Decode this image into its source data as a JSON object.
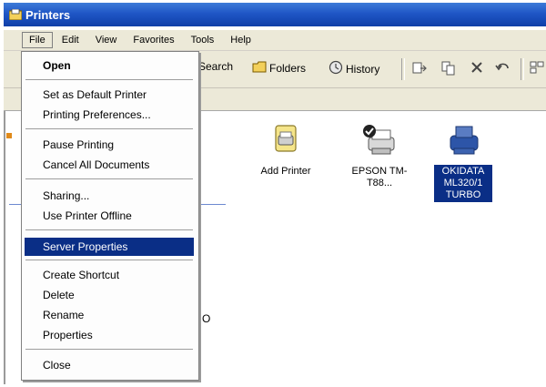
{
  "window": {
    "title": "Printers"
  },
  "menubar": [
    "File",
    "Edit",
    "View",
    "Favorites",
    "Tools",
    "Help"
  ],
  "toolbar": {
    "search": "Search",
    "folders": "Folders",
    "history": "History"
  },
  "file_menu": {
    "items": [
      "Open",
      "Set as Default Printer",
      "Printing Preferences...",
      "Pause Printing",
      "Cancel All Documents",
      "Sharing...",
      "Use Printer Offline",
      "Server Properties",
      "Create Shortcut",
      "Delete",
      "Rename",
      "Properties",
      "Close"
    ],
    "highlighted": "Server Properties"
  },
  "printers": [
    {
      "label": "Add Printer",
      "icon": "add-printer-icon"
    },
    {
      "label": "EPSON TM-T88...",
      "icon": "printer-default-icon"
    },
    {
      "label": "OKIDATA ML320/1 TURBO",
      "icon": "printer-icon",
      "selected": true
    }
  ],
  "background_fragments": {
    "partial_char": "O"
  },
  "colors": {
    "titlebar": "#1f56c6",
    "highlight": "#0a2e86",
    "chrome": "#ece9d8"
  }
}
